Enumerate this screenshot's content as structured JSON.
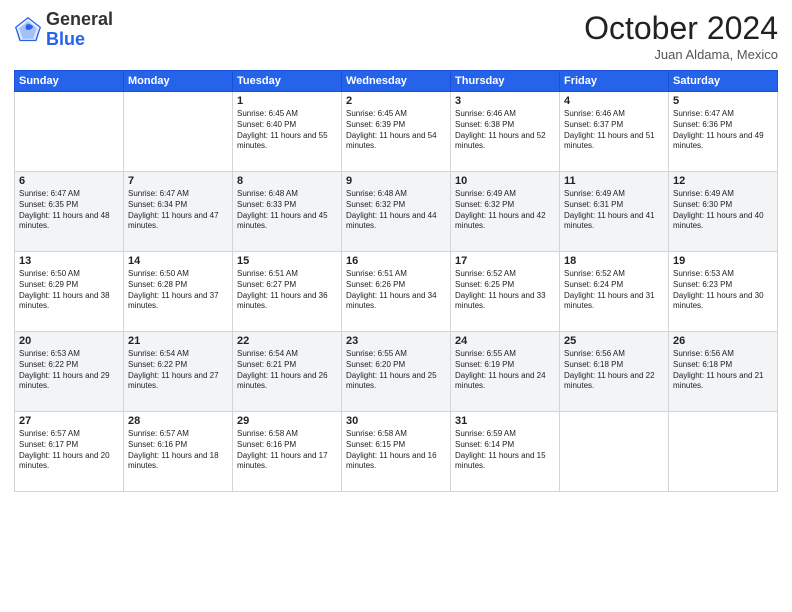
{
  "header": {
    "logo_general": "General",
    "logo_blue": "Blue",
    "month_title": "October 2024",
    "location": "Juan Aldama, Mexico"
  },
  "weekdays": [
    "Sunday",
    "Monday",
    "Tuesday",
    "Wednesday",
    "Thursday",
    "Friday",
    "Saturday"
  ],
  "weeks": [
    [
      {
        "day": "",
        "sunrise": "",
        "sunset": "",
        "daylight": ""
      },
      {
        "day": "",
        "sunrise": "",
        "sunset": "",
        "daylight": ""
      },
      {
        "day": "1",
        "sunrise": "Sunrise: 6:45 AM",
        "sunset": "Sunset: 6:40 PM",
        "daylight": "Daylight: 11 hours and 55 minutes."
      },
      {
        "day": "2",
        "sunrise": "Sunrise: 6:45 AM",
        "sunset": "Sunset: 6:39 PM",
        "daylight": "Daylight: 11 hours and 54 minutes."
      },
      {
        "day": "3",
        "sunrise": "Sunrise: 6:46 AM",
        "sunset": "Sunset: 6:38 PM",
        "daylight": "Daylight: 11 hours and 52 minutes."
      },
      {
        "day": "4",
        "sunrise": "Sunrise: 6:46 AM",
        "sunset": "Sunset: 6:37 PM",
        "daylight": "Daylight: 11 hours and 51 minutes."
      },
      {
        "day": "5",
        "sunrise": "Sunrise: 6:47 AM",
        "sunset": "Sunset: 6:36 PM",
        "daylight": "Daylight: 11 hours and 49 minutes."
      }
    ],
    [
      {
        "day": "6",
        "sunrise": "Sunrise: 6:47 AM",
        "sunset": "Sunset: 6:35 PM",
        "daylight": "Daylight: 11 hours and 48 minutes."
      },
      {
        "day": "7",
        "sunrise": "Sunrise: 6:47 AM",
        "sunset": "Sunset: 6:34 PM",
        "daylight": "Daylight: 11 hours and 47 minutes."
      },
      {
        "day": "8",
        "sunrise": "Sunrise: 6:48 AM",
        "sunset": "Sunset: 6:33 PM",
        "daylight": "Daylight: 11 hours and 45 minutes."
      },
      {
        "day": "9",
        "sunrise": "Sunrise: 6:48 AM",
        "sunset": "Sunset: 6:32 PM",
        "daylight": "Daylight: 11 hours and 44 minutes."
      },
      {
        "day": "10",
        "sunrise": "Sunrise: 6:49 AM",
        "sunset": "Sunset: 6:32 PM",
        "daylight": "Daylight: 11 hours and 42 minutes."
      },
      {
        "day": "11",
        "sunrise": "Sunrise: 6:49 AM",
        "sunset": "Sunset: 6:31 PM",
        "daylight": "Daylight: 11 hours and 41 minutes."
      },
      {
        "day": "12",
        "sunrise": "Sunrise: 6:49 AM",
        "sunset": "Sunset: 6:30 PM",
        "daylight": "Daylight: 11 hours and 40 minutes."
      }
    ],
    [
      {
        "day": "13",
        "sunrise": "Sunrise: 6:50 AM",
        "sunset": "Sunset: 6:29 PM",
        "daylight": "Daylight: 11 hours and 38 minutes."
      },
      {
        "day": "14",
        "sunrise": "Sunrise: 6:50 AM",
        "sunset": "Sunset: 6:28 PM",
        "daylight": "Daylight: 11 hours and 37 minutes."
      },
      {
        "day": "15",
        "sunrise": "Sunrise: 6:51 AM",
        "sunset": "Sunset: 6:27 PM",
        "daylight": "Daylight: 11 hours and 36 minutes."
      },
      {
        "day": "16",
        "sunrise": "Sunrise: 6:51 AM",
        "sunset": "Sunset: 6:26 PM",
        "daylight": "Daylight: 11 hours and 34 minutes."
      },
      {
        "day": "17",
        "sunrise": "Sunrise: 6:52 AM",
        "sunset": "Sunset: 6:25 PM",
        "daylight": "Daylight: 11 hours and 33 minutes."
      },
      {
        "day": "18",
        "sunrise": "Sunrise: 6:52 AM",
        "sunset": "Sunset: 6:24 PM",
        "daylight": "Daylight: 11 hours and 31 minutes."
      },
      {
        "day": "19",
        "sunrise": "Sunrise: 6:53 AM",
        "sunset": "Sunset: 6:23 PM",
        "daylight": "Daylight: 11 hours and 30 minutes."
      }
    ],
    [
      {
        "day": "20",
        "sunrise": "Sunrise: 6:53 AM",
        "sunset": "Sunset: 6:22 PM",
        "daylight": "Daylight: 11 hours and 29 minutes."
      },
      {
        "day": "21",
        "sunrise": "Sunrise: 6:54 AM",
        "sunset": "Sunset: 6:22 PM",
        "daylight": "Daylight: 11 hours and 27 minutes."
      },
      {
        "day": "22",
        "sunrise": "Sunrise: 6:54 AM",
        "sunset": "Sunset: 6:21 PM",
        "daylight": "Daylight: 11 hours and 26 minutes."
      },
      {
        "day": "23",
        "sunrise": "Sunrise: 6:55 AM",
        "sunset": "Sunset: 6:20 PM",
        "daylight": "Daylight: 11 hours and 25 minutes."
      },
      {
        "day": "24",
        "sunrise": "Sunrise: 6:55 AM",
        "sunset": "Sunset: 6:19 PM",
        "daylight": "Daylight: 11 hours and 24 minutes."
      },
      {
        "day": "25",
        "sunrise": "Sunrise: 6:56 AM",
        "sunset": "Sunset: 6:18 PM",
        "daylight": "Daylight: 11 hours and 22 minutes."
      },
      {
        "day": "26",
        "sunrise": "Sunrise: 6:56 AM",
        "sunset": "Sunset: 6:18 PM",
        "daylight": "Daylight: 11 hours and 21 minutes."
      }
    ],
    [
      {
        "day": "27",
        "sunrise": "Sunrise: 6:57 AM",
        "sunset": "Sunset: 6:17 PM",
        "daylight": "Daylight: 11 hours and 20 minutes."
      },
      {
        "day": "28",
        "sunrise": "Sunrise: 6:57 AM",
        "sunset": "Sunset: 6:16 PM",
        "daylight": "Daylight: 11 hours and 18 minutes."
      },
      {
        "day": "29",
        "sunrise": "Sunrise: 6:58 AM",
        "sunset": "Sunset: 6:16 PM",
        "daylight": "Daylight: 11 hours and 17 minutes."
      },
      {
        "day": "30",
        "sunrise": "Sunrise: 6:58 AM",
        "sunset": "Sunset: 6:15 PM",
        "daylight": "Daylight: 11 hours and 16 minutes."
      },
      {
        "day": "31",
        "sunrise": "Sunrise: 6:59 AM",
        "sunset": "Sunset: 6:14 PM",
        "daylight": "Daylight: 11 hours and 15 minutes."
      },
      {
        "day": "",
        "sunrise": "",
        "sunset": "",
        "daylight": ""
      },
      {
        "day": "",
        "sunrise": "",
        "sunset": "",
        "daylight": ""
      }
    ]
  ]
}
